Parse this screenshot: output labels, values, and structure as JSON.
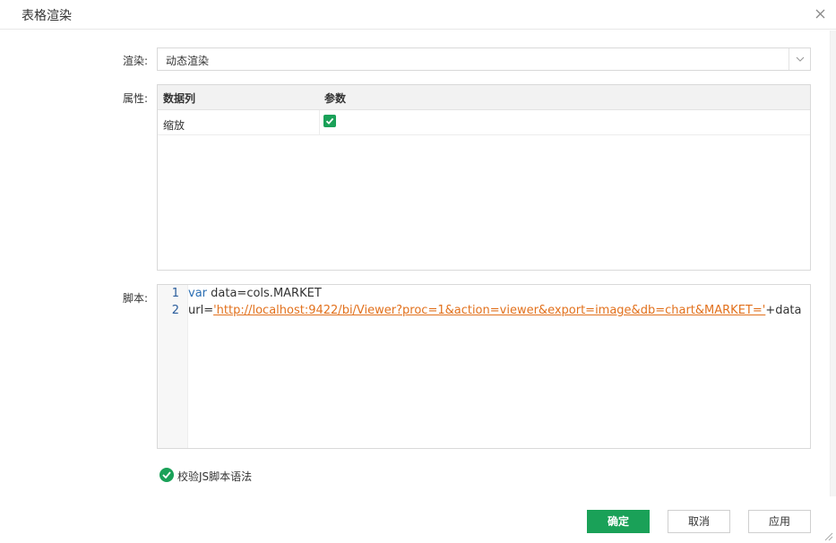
{
  "dialog": {
    "title": "表格渲染"
  },
  "render": {
    "label": "渲染:",
    "value": "动态渲染"
  },
  "properties": {
    "label": "属性:",
    "columns": [
      "数据列",
      "参数"
    ],
    "rows": [
      {
        "name": "缩放",
        "checked": true
      }
    ]
  },
  "script": {
    "label": "脚本:",
    "lines": [
      {
        "num": "1",
        "keyword": "var",
        "rest": " data=cols.MARKET"
      },
      {
        "num": "2",
        "prefix": "url=",
        "string": "'http://localhost:9422/bi/Viewer?proc=1&action=viewer&export=image&db=chart&MARKET='",
        "suffix": "+data"
      }
    ]
  },
  "validate": {
    "label": "校验JS脚本语法"
  },
  "buttons": {
    "ok": "确定",
    "cancel": "取消",
    "apply": "应用"
  },
  "colors": {
    "primary": "#1aa158",
    "keyword": "#2a6eb3",
    "string": "#e2711d"
  }
}
